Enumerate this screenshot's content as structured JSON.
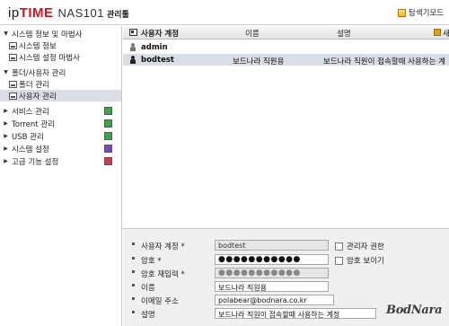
{
  "header": {
    "logo_ip": "ip",
    "logo_time": "TIME",
    "model": "NAS101",
    "admin_title": "관리툴",
    "explorer_button": "탐색기모드"
  },
  "sidebar": {
    "items": [
      {
        "label": "시스템 정보 및 마법사",
        "arrow": "▼",
        "level": 0
      },
      {
        "label": "시스템 정보",
        "level": 1
      },
      {
        "label": "시스템 설정 마법사",
        "level": 1
      },
      {
        "label": "폴더/사용자 관리",
        "arrow": "▼",
        "level": 0
      },
      {
        "label": "폴더 관리",
        "level": 1
      },
      {
        "label": "사용자 관리",
        "level": 1,
        "selected": true
      },
      {
        "label": "서비스 관리",
        "arrow": "▶",
        "level": 0,
        "badge": "green"
      },
      {
        "label": "Torrent 관리",
        "arrow": "▶",
        "level": 0,
        "badge": "green"
      },
      {
        "label": "USB 관리",
        "arrow": "▶",
        "level": 0,
        "badge": "green"
      },
      {
        "label": "시스템 설정",
        "arrow": "▶",
        "level": 0,
        "badge": "purple"
      },
      {
        "label": "고급 기능 설정",
        "arrow": "▶",
        "level": 0,
        "badge": "red"
      }
    ]
  },
  "user_table": {
    "columns": [
      "사용자 계정",
      "이름",
      "설명",
      "새"
    ],
    "rows": [
      {
        "account": "admin",
        "name": "",
        "description": "",
        "selected": false
      },
      {
        "account": "bodtest",
        "name": "보드나라 직원용",
        "description": "보드나라 직원이 접속할때 사용하는 계",
        "selected": true
      }
    ]
  },
  "user_form": {
    "account_label": "사용자 계정 *",
    "account_value": "bodtest",
    "admin_checkbox": "관리자 권한",
    "password_label": "암호 *",
    "password_value": "●●●●●●●●●●●",
    "show_password_checkbox": "암호 보이기",
    "password_confirm_label": "암호 재입력 *",
    "password_confirm_value": "●●●●●●●●●●●",
    "name_label": "이름",
    "name_value": "보드나라 직원용",
    "email_label": "이메일 주소",
    "email_value": "polabear@bodnara.co.kr",
    "description_label": "설명",
    "description_value": "보드나라 직원이 접속할때 사용하는 계정"
  },
  "watermark": "BodNara",
  "colors": {
    "brand_red": "#d2141c",
    "selection": "#d9dee6",
    "form_bg": "#f0f0f0"
  }
}
